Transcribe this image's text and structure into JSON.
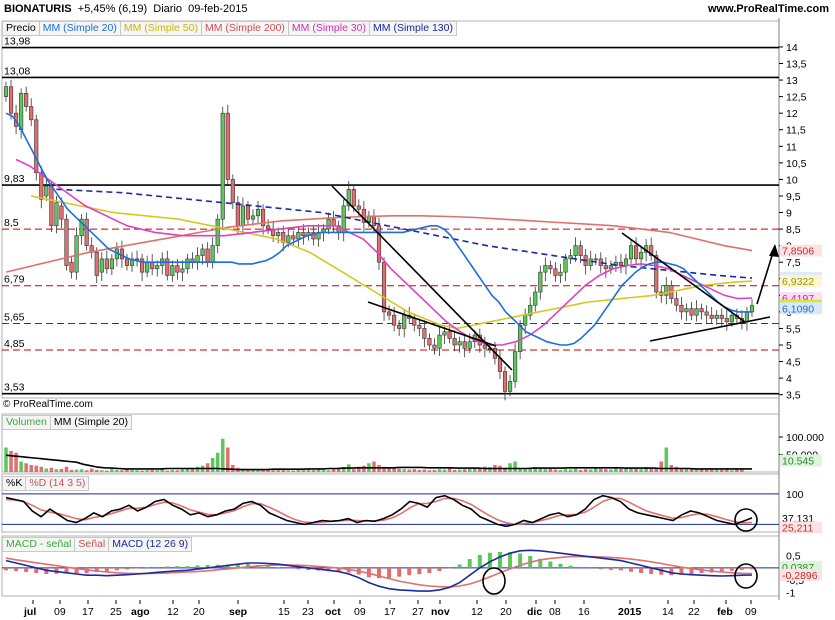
{
  "header": {
    "symbol": "BIONATURIS",
    "change": "+5,45% (6,19)",
    "interval": "Diario",
    "date": "09-feb-2015",
    "site": "www.ProRealTime.com",
    "copyright": "© ProRealTime.com"
  },
  "legends": {
    "price": [
      "Precio",
      "MM (Simple 20)",
      "MM (Simple 50)",
      "MM (Simple 200)",
      "MM (Simple 30)",
      "MM (Simple 130)"
    ],
    "volume": [
      "Volumen",
      "MM (Simple 20)"
    ],
    "stoch": [
      "%K",
      "%D (14 3 5)"
    ],
    "macd": [
      "MACD - señal",
      "Señal",
      "MACD (12 26 9)"
    ]
  },
  "colors": {
    "up": "#5cc85c",
    "down": "#e07070",
    "sma20": "#1a6fe0",
    "sma50": "#d4c81e",
    "sma200": "#e07070",
    "sma30": "#e040c0",
    "sma130": "#1a2aa0",
    "hline": "#000000",
    "dashline": "#cc0000"
  },
  "chart_data": {
    "type": "candlestick",
    "ylim": [
      3.4,
      14.3
    ],
    "y_ticks": [
      "14",
      "13,5",
      "13",
      "12,5",
      "12",
      "11,5",
      "11",
      "10,5",
      "10",
      "9,5",
      "9",
      "8,5",
      "8",
      "7,5",
      "7",
      "6,5",
      "6",
      "5,5",
      "5",
      "4,5",
      "4",
      "3,5"
    ],
    "x_ticks": [
      "jul",
      "09",
      "17",
      "25",
      "ago",
      "12",
      "20",
      "sep",
      "15",
      "23",
      "oct",
      "09",
      "17",
      "27",
      "nov",
      "12",
      "20",
      "dic",
      "08",
      "16",
      "2015",
      "14",
      "22",
      "feb",
      "09"
    ],
    "level_labels": [
      "13,98",
      "13,08",
      "9,83",
      "8,5",
      "6,79",
      "5,65",
      "4,85",
      "3,53"
    ],
    "last_price_labels": [
      "7,8506",
      "7,0239",
      "6,9322",
      "6,4197",
      "6,19",
      "6,1090"
    ],
    "volume_ticks": [
      "100.000",
      "50.000"
    ],
    "volume_last": "10.545",
    "stoch_ticks": [
      "100"
    ],
    "stoch_last": [
      "37,131",
      "25,211"
    ],
    "macd_ticks": [
      "0,5",
      "0",
      "-0,5",
      "-1"
    ],
    "macd_last": [
      "0,0387",
      "-0,2896"
    ],
    "candles_open": [
      12.5,
      12.8,
      12.0,
      11.5,
      12.6,
      12.2,
      11.8,
      10.2,
      9.5,
      9.8,
      8.6,
      9.2,
      8.8,
      7.5,
      7.2,
      8.3,
      8.8,
      8.0,
      7.8,
      7.2,
      7.6,
      7.3,
      7.6,
      7.9,
      7.6,
      7.4,
      7.6,
      7.6,
      7.2,
      7.5,
      7.3,
      7.4,
      7.6,
      7.1,
      7.4,
      7.2,
      7.3,
      7.6,
      7.5,
      7.7,
      7.9,
      7.5,
      8.0,
      8.8,
      12.0,
      10.0,
      9.3,
      8.6,
      9.2,
      8.8,
      8.9,
      9.1,
      8.6,
      8.5,
      8.3,
      8.4,
      8.1,
      8.3,
      8.2,
      8.4,
      8.3,
      8.4,
      8.2,
      8.4,
      8.5,
      8.8,
      8.6,
      8.4,
      9.2,
      9.7,
      9.2,
      9.1,
      8.7,
      8.9,
      8.6,
      7.5,
      6.0,
      5.9,
      5.6,
      5.5,
      5.9,
      5.8,
      5.6,
      5.5,
      5.2,
      5.0,
      4.9,
      5.3,
      5.4,
      5.2,
      5.0,
      5.1,
      4.9,
      5.1,
      5.3,
      5.0,
      4.9,
      4.9,
      4.6,
      4.2,
      3.6,
      3.9,
      4.8,
      5.6,
      5.9,
      6.2,
      6.6,
      7.2,
      7.4,
      7.3,
      7.1,
      7.2,
      7.6,
      7.7,
      8.0,
      7.7,
      7.4,
      7.6,
      7.6,
      7.4,
      7.3,
      7.4,
      7.5,
      7.4,
      7.6,
      8.0,
      7.6,
      7.8,
      8.0,
      7.7,
      6.6,
      6.5,
      6.8,
      6.4,
      6.2,
      6.0,
      6.1,
      5.9,
      6.1,
      6.0,
      5.9,
      5.8,
      5.9,
      5.8,
      5.7,
      5.9,
      5.8,
      5.7,
      6.0
    ],
    "candles_close": [
      12.8,
      12.0,
      11.6,
      12.6,
      12.2,
      11.8,
      10.2,
      9.4,
      9.8,
      8.6,
      9.3,
      8.8,
      7.4,
      7.2,
      8.3,
      8.8,
      8.0,
      7.8,
      7.1,
      7.6,
      7.3,
      7.6,
      7.9,
      7.6,
      7.4,
      7.6,
      7.6,
      7.2,
      7.5,
      7.3,
      7.4,
      7.6,
      7.1,
      7.4,
      7.2,
      7.3,
      7.6,
      7.5,
      7.7,
      7.9,
      7.5,
      8.0,
      8.8,
      12.0,
      10.0,
      9.3,
      8.6,
      9.2,
      8.8,
      8.9,
      9.1,
      8.6,
      8.5,
      8.3,
      8.4,
      8.1,
      8.3,
      8.2,
      8.4,
      8.3,
      8.4,
      8.2,
      8.4,
      8.5,
      8.8,
      8.6,
      8.4,
      9.2,
      9.7,
      9.2,
      9.1,
      8.7,
      8.9,
      8.6,
      7.5,
      6.0,
      5.9,
      5.6,
      5.5,
      5.9,
      5.8,
      5.6,
      5.5,
      5.2,
      5.0,
      4.9,
      5.3,
      5.4,
      5.2,
      5.0,
      5.1,
      4.9,
      5.1,
      5.3,
      5.0,
      4.9,
      4.9,
      4.6,
      4.2,
      3.6,
      3.9,
      4.8,
      5.6,
      5.9,
      6.2,
      6.6,
      7.2,
      7.4,
      7.3,
      7.1,
      7.2,
      7.6,
      7.7,
      8.0,
      7.7,
      7.4,
      7.6,
      7.6,
      7.4,
      7.3,
      7.4,
      7.5,
      7.4,
      7.6,
      8.0,
      7.6,
      7.8,
      8.0,
      7.7,
      6.6,
      6.5,
      6.8,
      6.4,
      6.2,
      6.0,
      6.1,
      5.9,
      6.1,
      6.0,
      5.9,
      5.8,
      5.9,
      5.8,
      5.7,
      5.9,
      5.8,
      5.7,
      6.0,
      6.19
    ],
    "sma20": [
      12.0,
      11.9,
      11.6,
      11.2,
      10.8,
      10.4,
      10.0,
      9.7,
      9.4,
      9.1,
      8.9,
      8.7,
      8.5,
      8.3,
      8.1,
      7.9,
      7.8,
      7.7,
      7.6,
      7.55,
      7.5,
      7.5,
      7.5,
      7.5,
      7.5,
      7.5,
      7.5,
      7.5,
      7.5,
      7.5,
      7.5,
      7.5,
      7.5,
      7.5,
      7.45,
      7.45,
      7.45,
      7.5,
      7.55,
      7.65,
      7.8,
      8.0,
      8.1,
      8.2,
      8.3,
      8.35,
      8.4,
      8.4,
      8.4,
      8.4,
      8.4,
      8.4,
      8.4,
      8.4,
      8.4,
      8.4,
      8.4,
      8.4,
      8.4,
      8.45,
      8.5,
      8.55,
      8.6,
      8.6,
      8.5,
      8.3,
      8.0,
      7.7,
      7.4,
      7.1,
      6.8,
      6.5,
      6.3,
      6.0,
      5.8,
      5.6,
      5.4,
      5.3,
      5.2,
      5.1,
      5.05,
      5.0,
      5.0,
      5.05,
      5.2,
      5.4,
      5.6,
      5.9,
      6.2,
      6.5,
      6.8,
      7.0,
      7.2,
      7.35,
      7.45,
      7.5,
      7.5,
      7.45,
      7.4,
      7.3,
      7.1,
      6.9,
      6.7,
      6.5,
      6.3,
      6.15,
      6.05,
      6.0,
      6.0,
      6.0
    ],
    "sma50": [
      9.5,
      9.4,
      9.3,
      9.2,
      9.1,
      9.0,
      8.95,
      8.9,
      8.85,
      8.8,
      8.7,
      8.6,
      8.5,
      8.4,
      8.3,
      8.2,
      8.0,
      7.8,
      7.5,
      7.2,
      6.9,
      6.6,
      6.3,
      6.0,
      5.8,
      5.6,
      5.5,
      5.6,
      5.7,
      5.8,
      5.9,
      6.0,
      6.1,
      6.2,
      6.3,
      6.35,
      6.4,
      6.45,
      6.5,
      6.6,
      6.7,
      6.8,
      6.85,
      6.9,
      6.93
    ],
    "sma200": [
      7.2,
      7.4,
      7.6,
      7.8,
      7.95,
      8.1,
      8.25,
      8.4,
      8.55,
      8.65,
      8.75,
      8.8,
      8.85,
      8.88,
      8.9,
      8.9,
      8.88,
      8.85,
      8.8,
      8.75,
      8.7,
      8.65,
      8.6,
      8.5,
      8.4,
      8.2,
      8.0,
      7.85
    ],
    "sma30": [
      10.6,
      10.4,
      10.1,
      9.8,
      9.5,
      9.2,
      9.0,
      8.8,
      8.6,
      8.5,
      8.4,
      8.35,
      8.3,
      8.3,
      8.3,
      8.3,
      8.35,
      8.4,
      8.45,
      8.5,
      8.55,
      8.6,
      8.6,
      8.6,
      8.4,
      8.2,
      7.8,
      7.3,
      6.9,
      6.5,
      6.1,
      5.7,
      5.4,
      5.15,
      5.0,
      5.0,
      5.1,
      5.3,
      5.6,
      6.0,
      6.4,
      6.8,
      7.1,
      7.3,
      7.4,
      7.45,
      7.4,
      7.3,
      7.1,
      6.9,
      6.7,
      6.5,
      6.4,
      6.42
    ],
    "sma130": [
      9.7,
      9.65,
      9.6,
      9.5,
      9.4,
      9.3,
      9.2,
      9.1,
      9.0,
      8.8,
      8.6,
      8.4,
      8.2,
      8.0,
      7.85,
      7.7,
      7.55,
      7.4,
      7.3,
      7.2,
      7.1,
      7.02
    ],
    "volume": [
      70,
      60,
      55,
      30,
      25,
      20,
      18,
      15,
      10,
      12,
      8,
      9,
      15,
      6,
      7,
      8,
      5,
      10,
      6,
      5,
      4,
      8,
      6,
      5,
      7,
      6,
      5,
      4,
      5,
      6,
      5,
      7,
      4,
      6,
      5,
      8,
      9,
      12,
      15,
      18,
      25,
      40,
      55,
      95,
      70,
      20,
      12,
      10,
      8,
      7,
      6,
      5,
      6,
      5,
      7,
      6,
      5,
      4,
      6,
      5,
      7,
      5,
      8,
      6,
      5,
      9,
      12,
      14,
      22,
      8,
      15,
      18,
      25,
      30,
      20,
      15,
      12,
      10,
      9,
      8,
      7,
      8,
      6,
      7,
      5,
      6,
      8,
      7,
      10,
      6,
      7,
      8,
      9,
      12,
      10,
      15,
      14,
      20,
      18,
      12,
      25,
      30,
      10,
      8,
      12,
      14,
      10,
      8,
      9,
      7,
      6,
      8,
      7,
      9,
      6,
      8,
      7,
      10,
      9,
      8,
      7,
      11,
      9,
      10,
      12,
      10,
      8,
      14,
      9,
      12,
      30,
      70,
      20,
      15,
      10,
      12,
      9,
      8,
      10,
      7,
      9,
      8,
      6,
      7,
      5,
      8,
      10
    ],
    "volume_ma": [
      48,
      46,
      44,
      42,
      40,
      38,
      36,
      34,
      32,
      30,
      28,
      22,
      18,
      14,
      12,
      11,
      10,
      9,
      9,
      9,
      9,
      9,
      9,
      10,
      10,
      10,
      10,
      10,
      10,
      10,
      10,
      9,
      8,
      7,
      7,
      7,
      7,
      7,
      8,
      8,
      8,
      8,
      8,
      9,
      9,
      9,
      10,
      10,
      11,
      11,
      12,
      12,
      12,
      12,
      12,
      12,
      13,
      13,
      13,
      13,
      12,
      12,
      12,
      12,
      11,
      11,
      11,
      11,
      10,
      10,
      10,
      10,
      10,
      10,
      10,
      11,
      11,
      11,
      11,
      11,
      12,
      12,
      12,
      12,
      12,
      12,
      12,
      12,
      11,
      11,
      11,
      11,
      11,
      10,
      10,
      10,
      10,
      10,
      9,
      9,
      9,
      9,
      9,
      9,
      9,
      9,
      9
    ],
    "stoch_k": [
      90,
      85,
      80,
      55,
      40,
      60,
      45,
      30,
      25,
      35,
      50,
      40,
      55,
      60,
      70,
      55,
      65,
      80,
      85,
      70,
      60,
      45,
      50,
      40,
      45,
      55,
      60,
      75,
      80,
      70,
      50,
      40,
      30,
      25,
      20,
      25,
      30,
      28,
      30,
      35,
      25,
      30,
      28,
      35,
      45,
      60,
      80,
      75,
      65,
      90,
      95,
      85,
      70,
      60,
      40,
      30,
      20,
      15,
      20,
      30,
      25,
      35,
      45,
      50,
      40,
      45,
      60,
      85,
      95,
      90,
      80,
      60,
      50,
      45,
      40,
      35,
      30,
      45,
      55,
      50,
      40,
      30,
      25,
      20,
      28,
      37
    ],
    "stoch_d": [
      85,
      84,
      80,
      70,
      58,
      52,
      48,
      42,
      35,
      32,
      38,
      42,
      48,
      55,
      62,
      62,
      65,
      72,
      78,
      76,
      68,
      58,
      52,
      46,
      45,
      50,
      56,
      66,
      74,
      74,
      65,
      54,
      42,
      32,
      26,
      24,
      26,
      28,
      29,
      31,
      30,
      29,
      29,
      31,
      37,
      48,
      63,
      74,
      75,
      80,
      88,
      88,
      82,
      72,
      58,
      44,
      32,
      24,
      20,
      22,
      25,
      30,
      36,
      43,
      45,
      46,
      52,
      65,
      80,
      88,
      88,
      78,
      66,
      55,
      48,
      42,
      36,
      38,
      44,
      48,
      46,
      40,
      33,
      27,
      24,
      25
    ],
    "macd": [
      0.3,
      0.2,
      0.1,
      0.0,
      -0.1,
      -0.15,
      -0.2,
      -0.25,
      -0.3,
      -0.3,
      -0.32,
      -0.3,
      -0.28,
      -0.25,
      -0.22,
      -0.18,
      -0.15,
      -0.12,
      -0.1,
      -0.05,
      0.0,
      0.05,
      0.1,
      0.15,
      0.2,
      0.2,
      0.18,
      0.15,
      0.1,
      0.05,
      0.0,
      -0.05,
      -0.1,
      -0.15,
      -0.25,
      -0.4,
      -0.6,
      -0.75,
      -0.85,
      -0.9,
      -0.92,
      -0.95,
      -0.95,
      -0.9,
      -0.8,
      -0.6,
      -0.3,
      0.0,
      0.25,
      0.45,
      0.6,
      0.7,
      0.72,
      0.7,
      0.65,
      0.6,
      0.55,
      0.5,
      0.45,
      0.4,
      0.35,
      0.3,
      0.2,
      0.1,
      0.0,
      -0.1,
      -0.2,
      -0.25,
      -0.28,
      -0.3,
      -0.32,
      -0.33,
      -0.32,
      -0.3,
      -0.29
    ],
    "macd_signal": [
      0.4,
      0.33,
      0.27,
      0.21,
      0.15,
      0.09,
      0.03,
      -0.03,
      -0.08,
      -0.13,
      -0.17,
      -0.2,
      -0.22,
      -0.23,
      -0.23,
      -0.22,
      -0.21,
      -0.19,
      -0.17,
      -0.15,
      -0.12,
      -0.08,
      -0.04,
      0.0,
      0.04,
      0.08,
      0.1,
      0.12,
      0.12,
      0.11,
      0.09,
      0.06,
      0.03,
      -0.01,
      -0.06,
      -0.13,
      -0.22,
      -0.33,
      -0.44,
      -0.54,
      -0.62,
      -0.69,
      -0.74,
      -0.77,
      -0.78,
      -0.74,
      -0.66,
      -0.53,
      -0.37,
      -0.2,
      -0.04,
      0.11,
      0.23,
      0.33,
      0.39,
      0.43,
      0.46,
      0.46,
      0.46,
      0.45,
      0.43,
      0.4,
      0.36,
      0.31,
      0.25,
      0.18,
      0.1,
      0.03,
      -0.03,
      -0.09,
      -0.13,
      -0.17,
      -0.2,
      -0.22,
      -0.23
    ]
  }
}
